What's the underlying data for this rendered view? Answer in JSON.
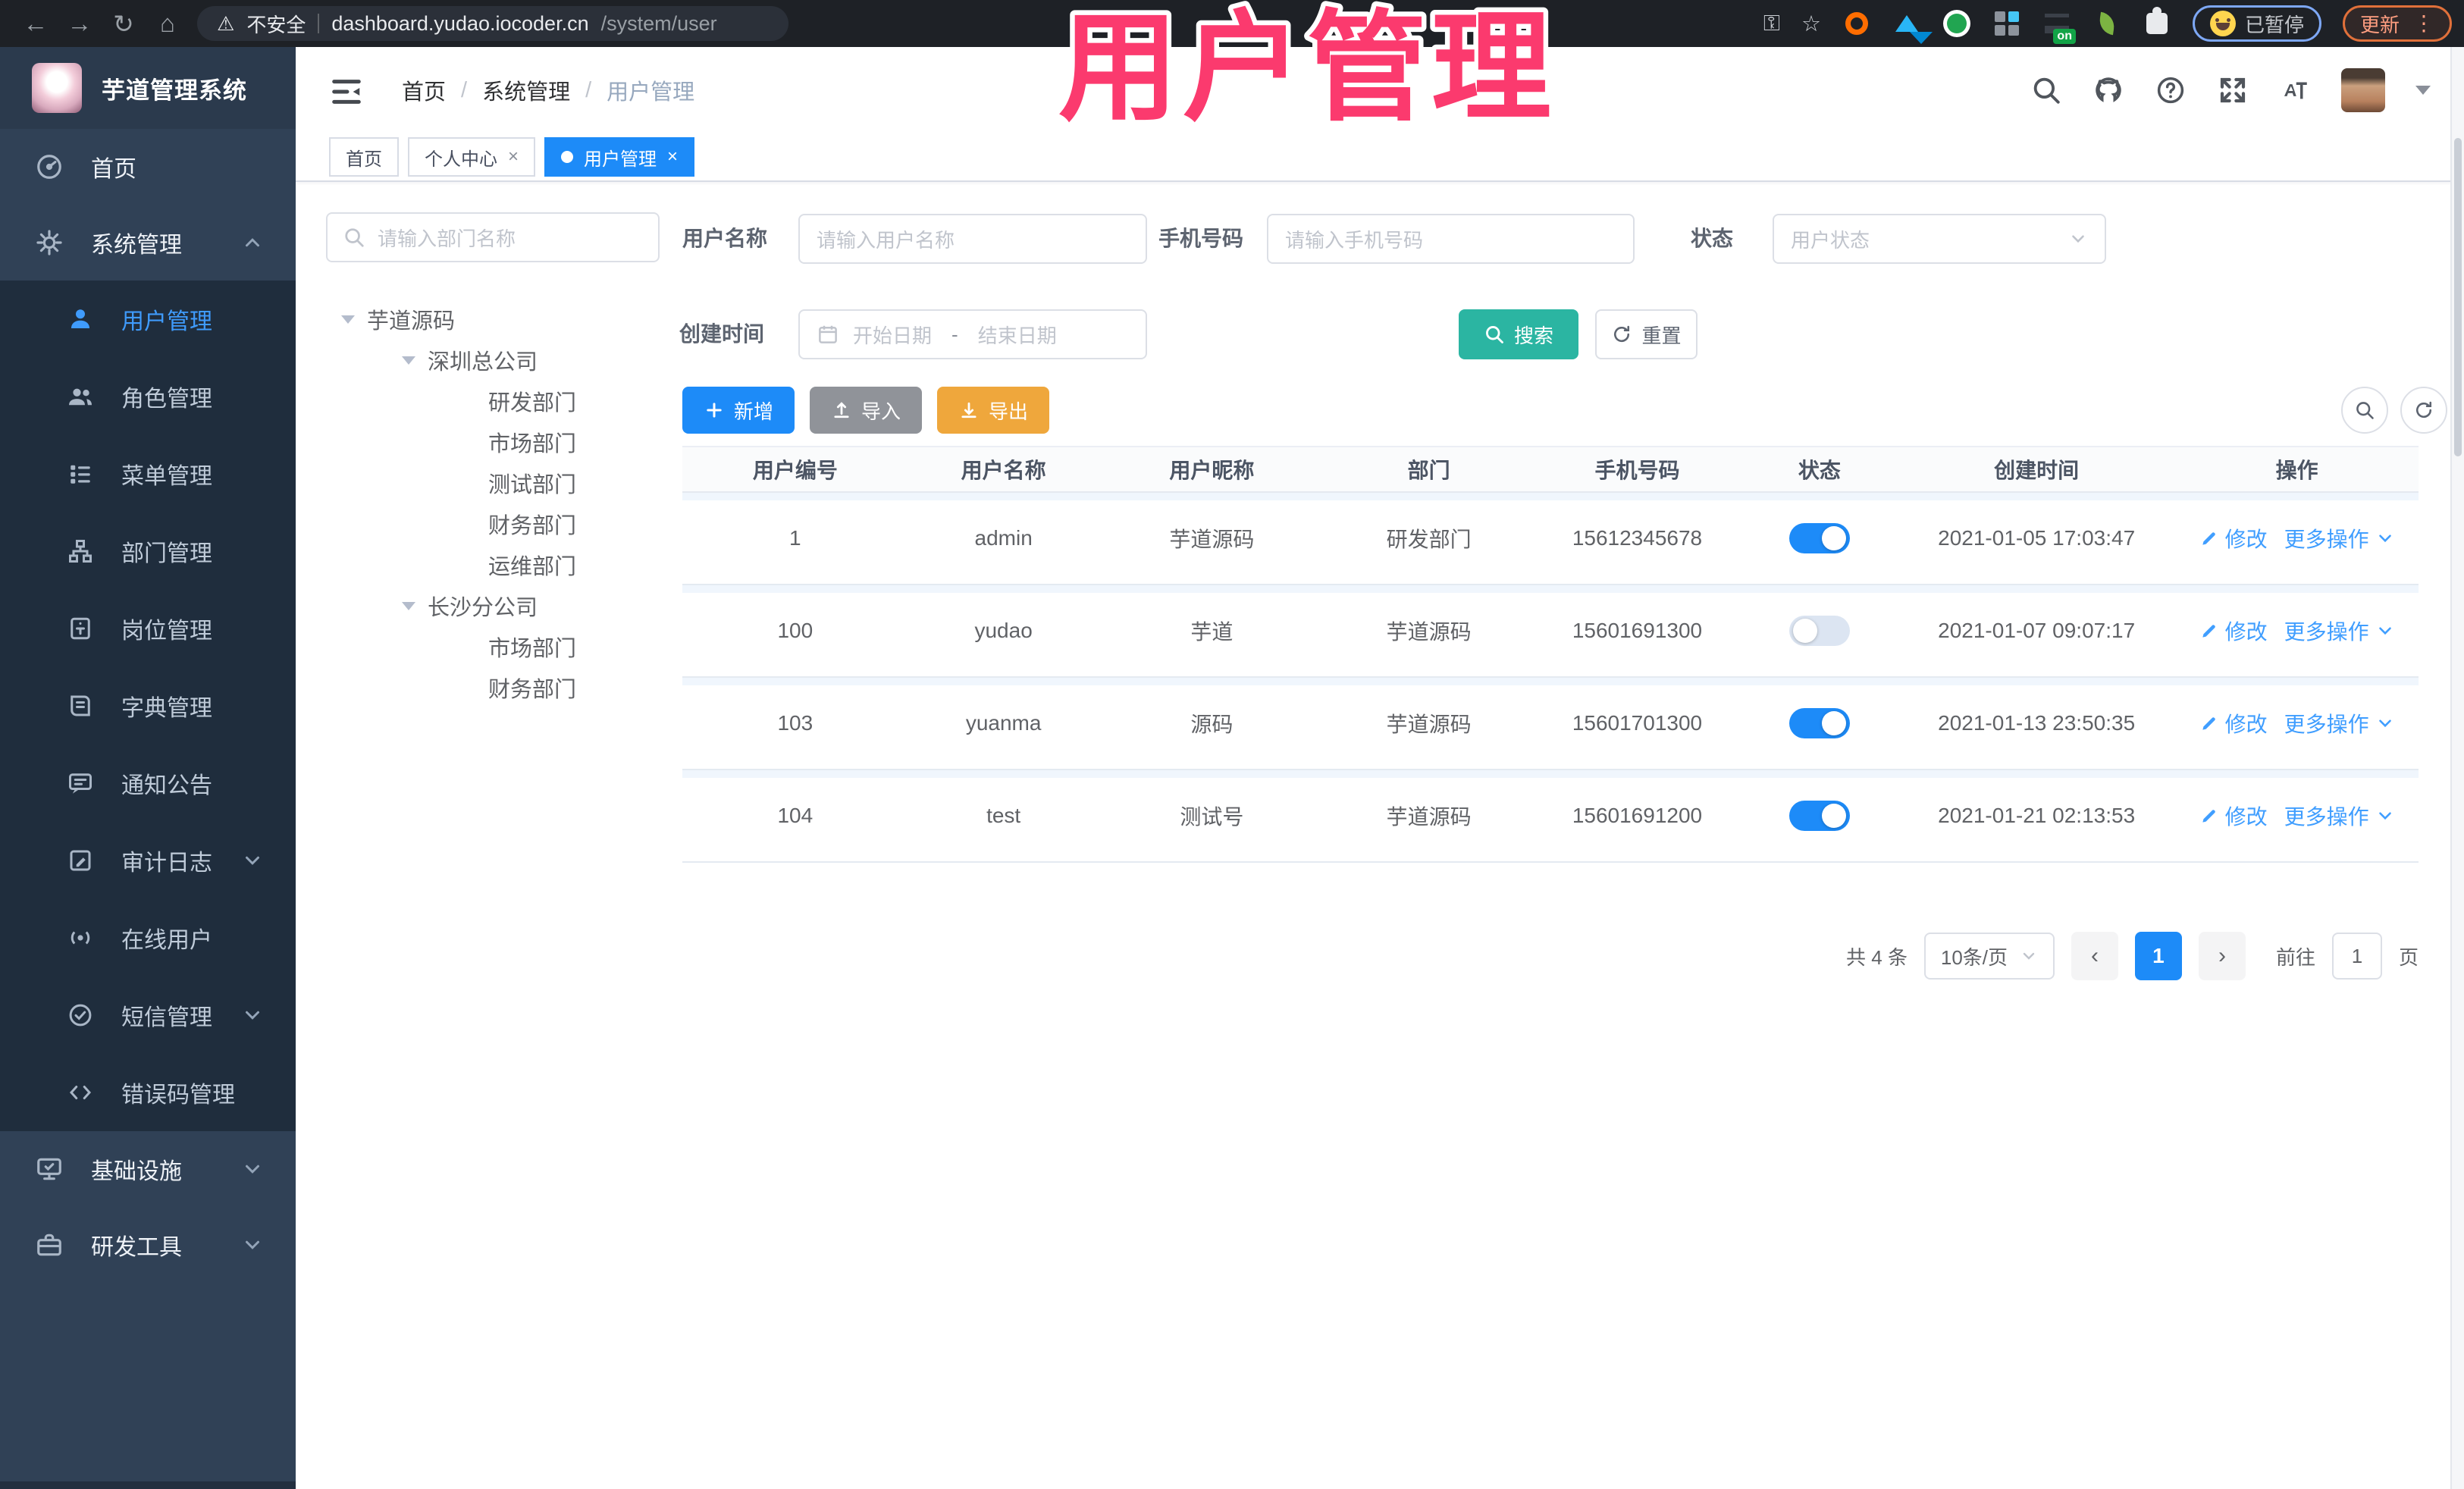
{
  "browser": {
    "back": "←",
    "forward": "→",
    "reload": "↻",
    "home": "⌂",
    "warning_glyph": "⚠",
    "security_label": "不安全",
    "url_host": "dashboard.yudao.iocoder.cn",
    "url_path": "/system/user",
    "key_glyph": "⚿",
    "star_glyph": "☆",
    "extension_on_badge": "on",
    "paused_badge": "已暂停",
    "update_label": "更新",
    "kebab_glyph": "⋮"
  },
  "overlay_title": "用户管理",
  "app": {
    "logo_title": "芋道管理系统"
  },
  "breadcrumb": {
    "items": [
      "首页",
      "系统管理",
      "用户管理"
    ],
    "separator": "/"
  },
  "tabs": [
    {
      "label": "首页"
    },
    {
      "label": "个人中心",
      "close": "×"
    },
    {
      "label": "用户管理",
      "close": "×"
    }
  ],
  "sidebar": {
    "home": "首页",
    "system": "系统管理",
    "submenu": [
      {
        "label": "用户管理",
        "active": true
      },
      {
        "label": "角色管理"
      },
      {
        "label": "菜单管理"
      },
      {
        "label": "部门管理"
      },
      {
        "label": "岗位管理"
      },
      {
        "label": "字典管理"
      },
      {
        "label": "通知公告"
      },
      {
        "label": "审计日志"
      },
      {
        "label": "在线用户"
      },
      {
        "label": "短信管理"
      },
      {
        "label": "错误码管理"
      }
    ],
    "infra": "基础设施",
    "tools": "研发工具"
  },
  "dept_panel": {
    "search_placeholder": "请输入部门名称",
    "tree": [
      {
        "label": "芋道源码"
      },
      {
        "label": "深圳总公司"
      },
      {
        "label": "研发部门"
      },
      {
        "label": "市场部门"
      },
      {
        "label": "测试部门"
      },
      {
        "label": "财务部门"
      },
      {
        "label": "运维部门"
      },
      {
        "label": "长沙分公司"
      },
      {
        "label": "市场部门"
      },
      {
        "label": "财务部门"
      }
    ]
  },
  "filters": {
    "username_label": "用户名称",
    "username_placeholder": "请输入用户名称",
    "mobile_label": "手机号码",
    "mobile_placeholder": "请输入手机号码",
    "status_label": "状态",
    "status_placeholder": "用户状态",
    "created_label": "创建时间",
    "date_start_placeholder": "开始日期",
    "date_separator": "-",
    "date_end_placeholder": "结束日期",
    "search_label": "搜索",
    "reset_label": "重置"
  },
  "toolbar": {
    "add_label": "新增",
    "import_label": "导入",
    "export_label": "导出"
  },
  "table": {
    "columns": [
      "用户编号",
      "用户名称",
      "用户昵称",
      "部门",
      "手机号码",
      "状态",
      "创建时间",
      "操作"
    ],
    "edit_label": "修改",
    "more_label": "更多操作",
    "rows": [
      {
        "id": "1",
        "username": "admin",
        "nickname": "芋道源码",
        "dept": "研发部门",
        "mobile": "15612345678",
        "status": true,
        "created": "2021-01-05 17:03:47"
      },
      {
        "id": "100",
        "username": "yudao",
        "nickname": "芋道",
        "dept": "芋道源码",
        "mobile": "15601691300",
        "status": false,
        "created": "2021-01-07 09:07:17"
      },
      {
        "id": "103",
        "username": "yuanma",
        "nickname": "源码",
        "dept": "芋道源码",
        "mobile": "15601701300",
        "status": true,
        "created": "2021-01-13 23:50:35"
      },
      {
        "id": "104",
        "username": "test",
        "nickname": "测试号",
        "dept": "芋道源码",
        "mobile": "15601691200",
        "status": true,
        "created": "2021-01-21 02:13:53"
      }
    ]
  },
  "pagination": {
    "total": "共 4 条",
    "page_size": "10条/页",
    "prev": "‹",
    "next": "›",
    "current": "1",
    "goto_label": "前往",
    "goto_value": "1",
    "page_unit": "页"
  },
  "colors": {
    "accent": "#1d8bf8",
    "link": "#409eff",
    "teal_search": "#2bb5a2",
    "warning_export": "#efa73c",
    "info_import": "#909399",
    "sidebar_bg": "#304156",
    "submenu_bg": "#1f2d3d",
    "annotation_pink": "#fb3a6e"
  }
}
